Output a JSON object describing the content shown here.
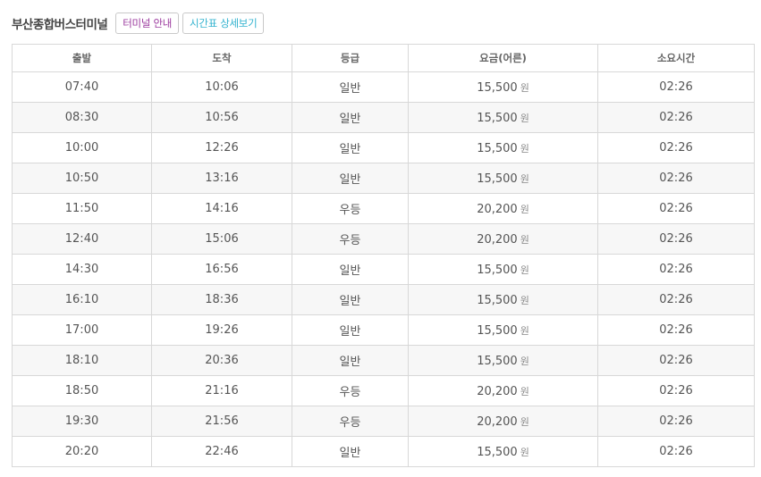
{
  "header": {
    "terminal_name": "부산종합버스터미널",
    "info_button": "터미널 안내",
    "timetable_button": "시간표 상세보기",
    "colors": {
      "info_button": "#9b3a9e",
      "timetable_button": "#34b3cf"
    }
  },
  "table": {
    "columns": [
      "출발",
      "도착",
      "등급",
      "요금(어른)",
      "소요시간"
    ],
    "currency_unit": "원",
    "rows": [
      {
        "depart": "07:40",
        "arrive": "10:06",
        "grade": "일반",
        "fare": "15,500",
        "duration": "02:26"
      },
      {
        "depart": "08:30",
        "arrive": "10:56",
        "grade": "일반",
        "fare": "15,500",
        "duration": "02:26"
      },
      {
        "depart": "10:00",
        "arrive": "12:26",
        "grade": "일반",
        "fare": "15,500",
        "duration": "02:26"
      },
      {
        "depart": "10:50",
        "arrive": "13:16",
        "grade": "일반",
        "fare": "15,500",
        "duration": "02:26"
      },
      {
        "depart": "11:50",
        "arrive": "14:16",
        "grade": "우등",
        "fare": "20,200",
        "duration": "02:26"
      },
      {
        "depart": "12:40",
        "arrive": "15:06",
        "grade": "우등",
        "fare": "20,200",
        "duration": "02:26"
      },
      {
        "depart": "14:30",
        "arrive": "16:56",
        "grade": "일반",
        "fare": "15,500",
        "duration": "02:26"
      },
      {
        "depart": "16:10",
        "arrive": "18:36",
        "grade": "일반",
        "fare": "15,500",
        "duration": "02:26"
      },
      {
        "depart": "17:00",
        "arrive": "19:26",
        "grade": "일반",
        "fare": "15,500",
        "duration": "02:26"
      },
      {
        "depart": "18:10",
        "arrive": "20:36",
        "grade": "일반",
        "fare": "15,500",
        "duration": "02:26"
      },
      {
        "depart": "18:50",
        "arrive": "21:16",
        "grade": "우등",
        "fare": "20,200",
        "duration": "02:26"
      },
      {
        "depart": "19:30",
        "arrive": "21:56",
        "grade": "우등",
        "fare": "20,200",
        "duration": "02:26"
      },
      {
        "depart": "20:20",
        "arrive": "22:46",
        "grade": "일반",
        "fare": "15,500",
        "duration": "02:26"
      }
    ]
  }
}
